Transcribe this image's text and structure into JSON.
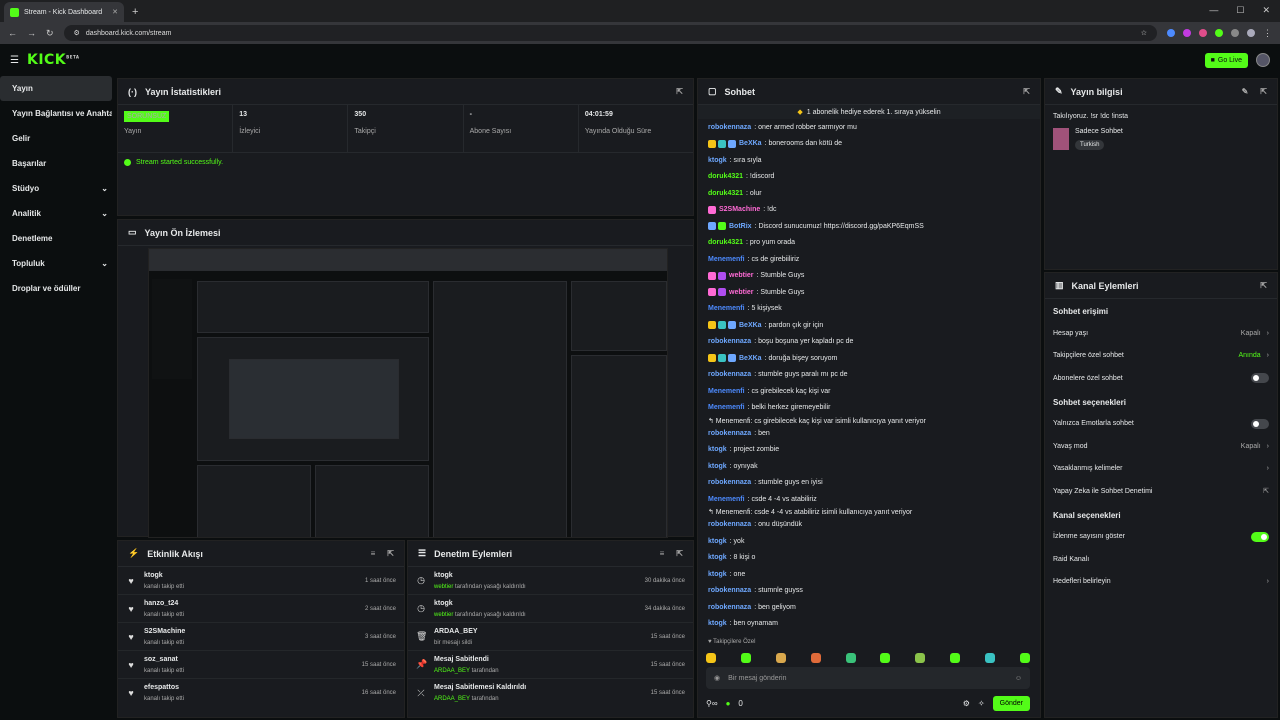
{
  "browser": {
    "tab_title": "Stream - Kick Dashboard",
    "new_tab": "+",
    "url": "dashboard.kick.com/stream"
  },
  "header": {
    "logo": "KICK",
    "logo_sup": "BETA",
    "go_live": "Go Live"
  },
  "sidebar": {
    "items": [
      {
        "label": "Yayın",
        "chev": ""
      },
      {
        "label": "Yayın Bağlantısı ve Anahtarı",
        "chev": ""
      },
      {
        "label": "Gelir",
        "chev": ""
      },
      {
        "label": "Başarılar",
        "chev": ""
      },
      {
        "label": "Stüdyo",
        "chev": "⌄"
      },
      {
        "label": "Analitik",
        "chev": "⌄"
      },
      {
        "label": "Denetleme",
        "chev": ""
      },
      {
        "label": "Topluluk",
        "chev": "⌄"
      },
      {
        "label": "Droplar ve ödüller",
        "chev": ""
      }
    ]
  },
  "stats": {
    "title": "Yayın İstatistikleri",
    "badge": "SORUNSUZ",
    "items": [
      {
        "value": "",
        "label": "Yayın"
      },
      {
        "value": "13",
        "label": "İzleyici"
      },
      {
        "value": "350",
        "label": "Takipçi"
      },
      {
        "value": "-",
        "label": "Abone Sayısı"
      },
      {
        "value": "04:01:59",
        "label": "Yayında Olduğu Süre"
      }
    ],
    "success": "Stream started successfully."
  },
  "preview": {
    "title": "Yayın Ön İzlemesi"
  },
  "activity": {
    "title": "Etkinlik Akışı",
    "items": [
      {
        "user": "ktogk",
        "text": "kanalı takip etti",
        "time": "1 saat önce"
      },
      {
        "user": "hanzo_t24",
        "text": "kanalı takip etti",
        "time": "2 saat önce"
      },
      {
        "user": "S2SMachine",
        "text": "kanalı takip etti",
        "time": "3 saat önce"
      },
      {
        "user": "soz_sanat",
        "text": "kanalı takip etti",
        "time": "15 saat önce"
      },
      {
        "user": "efespattos",
        "text": "kanalı takip etti",
        "time": "16 saat önce"
      }
    ]
  },
  "mod": {
    "title": "Denetim Eylemleri",
    "items": [
      {
        "icon": "◷",
        "name": "clock-icon",
        "user": "ktogk",
        "who": "webtier",
        "text": " tarafından yasağı kaldırıldı",
        "time": "30 dakika önce"
      },
      {
        "icon": "◷",
        "name": "clock-icon",
        "user": "ktogk",
        "who": "webtier",
        "text": " tarafından yasağı kaldırıldı",
        "time": "34 dakika önce"
      },
      {
        "icon": "🗑",
        "name": "trash-icon",
        "user": "ARDAA_BEY",
        "who": "",
        "text": "bir mesajı sildi",
        "time": "15 saat önce"
      },
      {
        "icon": "📌",
        "name": "pin-icon",
        "user": "Mesaj Sabitlendi",
        "who": "ARDAA_BEY",
        "text": " tarafından",
        "time": "15 saat önce"
      },
      {
        "icon": "⤫",
        "name": "unpin-icon",
        "user": "Mesaj Sabitlemesi Kaldırıldı",
        "who": "ARDAA_BEY",
        "text": " tarafından",
        "time": "15 saat önce"
      }
    ]
  },
  "chat": {
    "title": "Sohbet",
    "banner": "1 abonelik hediye ederek 1. sıraya yükselin",
    "messages": [
      {
        "user": "robokennaza",
        "color": "#6ea8ff",
        "text": ": oner armed robber sarmıyor mu",
        "badges": []
      },
      {
        "user": "BeXKa",
        "color": "#6ea8ff",
        "text": ": bonerooms dan kötü de",
        "badges": [
          "#f5c518",
          "#3ac2c2",
          "#6ea8ff"
        ]
      },
      {
        "user": "ktogk",
        "color": "#6ea8ff",
        "text": ": sıra sıyla",
        "badges": []
      },
      {
        "user": "doruk4321",
        "color": "#53fc18",
        "text": ": !discord",
        "badges": []
      },
      {
        "user": "doruk4321",
        "color": "#53fc18",
        "text": ": olur",
        "badges": []
      },
      {
        "user": "S2SMachine",
        "color": "#ff6ad5",
        "text": ": !dc",
        "badges": [
          "#ff6ad5"
        ]
      },
      {
        "user": "BotRix",
        "color": "#6ea8ff",
        "text": ": Discord sunucumuz! https://discord.gg/paKP6EqmSS",
        "badges": [
          "#6ea8ff",
          "#53fc18"
        ]
      },
      {
        "user": "doruk4321",
        "color": "#53fc18",
        "text": ": pro yum orada",
        "badges": []
      },
      {
        "user": "Menemenfi",
        "color": "#4d8bff",
        "text": ": cs de girebiiliriz",
        "badges": []
      },
      {
        "user": "webtier",
        "color": "#ff6ad5",
        "text": ": Stumble Guys",
        "badges": [
          "#ff6ad5",
          "#b04df0"
        ]
      },
      {
        "user": "webtier",
        "color": "#ff6ad5",
        "text": ": Stumble Guys",
        "badges": [
          "#ff6ad5",
          "#b04df0"
        ]
      },
      {
        "user": "Menemenfi",
        "color": "#4d8bff",
        "text": ": 5 kişiysek",
        "badges": []
      },
      {
        "user": "BeXKa",
        "color": "#6ea8ff",
        "text": ": pardon çık gir için",
        "badges": [
          "#f5c518",
          "#3ac2c2",
          "#6ea8ff"
        ]
      },
      {
        "user": "robokennaza",
        "color": "#6ea8ff",
        "text": ": boşu boşuna yer kapladı pc de",
        "badges": []
      },
      {
        "user": "BeXKa",
        "color": "#6ea8ff",
        "text": ": doruğa bişey soruyom",
        "badges": [
          "#f5c518",
          "#3ac2c2",
          "#6ea8ff"
        ]
      },
      {
        "user": "robokennaza",
        "color": "#6ea8ff",
        "text": ": stumble guys paralı mı pc de",
        "badges": []
      },
      {
        "user": "Menemenfi",
        "color": "#4d8bff",
        "text": ": cs girebilecek kaç kişi var",
        "badges": []
      },
      {
        "user": "Menemenfi",
        "color": "#4d8bff",
        "text": ": belki herkez giremeyebilir",
        "badges": []
      },
      {
        "user": "robokennaza",
        "color": "#6ea8ff",
        "text": ": ben",
        "badges": [],
        "reply": "↰ Menemenfi: cs girebilecek kaç kişi var isimli kullanıcıya yanıt veriyor"
      },
      {
        "user": "ktogk",
        "color": "#6ea8ff",
        "text": ": project zombie",
        "badges": []
      },
      {
        "user": "ktogk",
        "color": "#6ea8ff",
        "text": ": oynıyak",
        "badges": []
      },
      {
        "user": "robokennaza",
        "color": "#6ea8ff",
        "text": ": stumble guys en iyisi",
        "badges": []
      },
      {
        "user": "Menemenfi",
        "color": "#4d8bff",
        "text": ": csde 4 -4 vs atabiliriz",
        "badges": []
      },
      {
        "user": "robokennaza",
        "color": "#6ea8ff",
        "text": ": onu düşündük",
        "badges": [],
        "reply": "↰ Menemenfi: csde 4 -4 vs atabiliriz isimli kullanıcıya yanıt veriyor"
      },
      {
        "user": "ktogk",
        "color": "#6ea8ff",
        "text": ": yok",
        "badges": []
      },
      {
        "user": "ktogk",
        "color": "#6ea8ff",
        "text": ": 8 kişi o",
        "badges": []
      },
      {
        "user": "ktogk",
        "color": "#6ea8ff",
        "text": ": one",
        "badges": []
      },
      {
        "user": "robokennaza",
        "color": "#6ea8ff",
        "text": ": stumnle guyss",
        "badges": []
      },
      {
        "user": "robokennaza",
        "color": "#6ea8ff",
        "text": ": ben geliyom",
        "badges": []
      },
      {
        "user": "ktogk",
        "color": "#6ea8ff",
        "text": ": ben oynamam",
        "badges": []
      }
    ],
    "followers_only": "♥ Takipçilere Özel",
    "placeholder": "Bir mesaj gönderin",
    "count": "0",
    "send": "Gönder"
  },
  "info": {
    "title": "Yayın bilgisi",
    "stream_title": "Takılıyoruz. !sr !dc !insta",
    "category": "Sadece Sohbet",
    "tag": "Turkish"
  },
  "actions": {
    "title": "Kanal Eylemleri",
    "sec1": "Sohbet erişimi",
    "access": [
      {
        "label": "Hesap yaşı",
        "value": "Kapalı",
        "type": "link"
      },
      {
        "label": "Takipçilere özel sohbet",
        "value": "Anında",
        "type": "link-green"
      },
      {
        "label": "Abonelere özel sohbet",
        "value": "",
        "type": "toggle"
      }
    ],
    "sec2": "Sohbet seçenekleri",
    "options": [
      {
        "label": "Yalnızca Emotlarla sohbet",
        "value": "",
        "type": "toggle"
      },
      {
        "label": "Yavaş mod",
        "value": "Kapalı",
        "type": "link"
      },
      {
        "label": "Yasaklanmış kelimeler",
        "value": "",
        "type": "link"
      },
      {
        "label": "Yapay Zeka ile Sohbet Denetimi",
        "value": "",
        "type": "ext"
      }
    ],
    "sec3": "Kanal seçenekleri",
    "channel": [
      {
        "label": "İzlenme sayısını göster",
        "value": "",
        "type": "toggle-on"
      },
      {
        "label": "Raid Kanalı",
        "value": "",
        "type": "none"
      },
      {
        "label": "Hedefleri belirleyin",
        "value": "",
        "type": "link"
      }
    ]
  },
  "colors": {
    "accent": "#53fc18",
    "bg": "#0b0e0f",
    "panel": "#191b1f"
  }
}
